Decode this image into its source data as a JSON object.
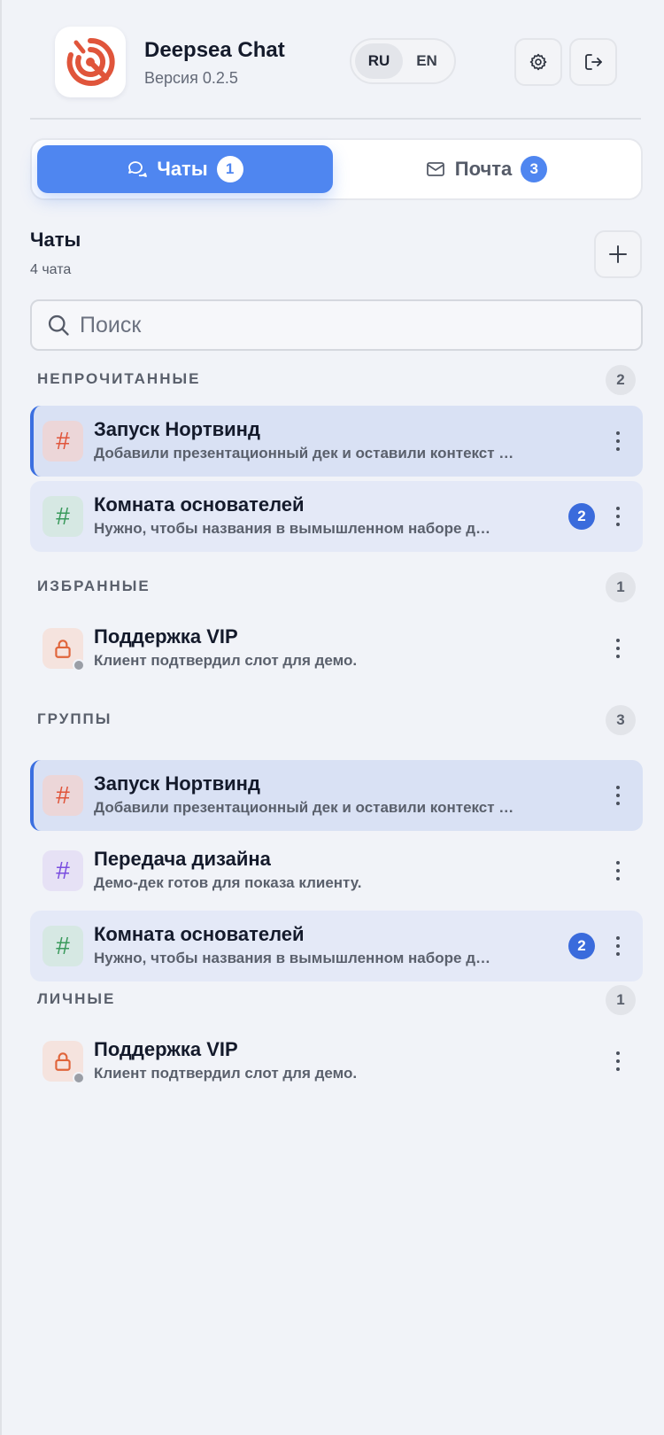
{
  "app": {
    "title": "Deepsea Chat",
    "version": "Версия 0.2.5",
    "brand_color": "#e0553b"
  },
  "languages": [
    {
      "code": "RU",
      "active": true
    },
    {
      "code": "EN",
      "active": false
    }
  ],
  "header_icons": [
    "gear-icon",
    "logout-icon"
  ],
  "tabs": [
    {
      "label": "Чаты",
      "badge": "1",
      "icon": "chat-bubbles-icon",
      "active": true
    },
    {
      "label": "Почта",
      "badge": "3",
      "icon": "envelope-icon",
      "active": false
    }
  ],
  "list": {
    "title": "Чаты",
    "count": "4 чата"
  },
  "search": {
    "placeholder": "Поиск",
    "value": ""
  },
  "groups": [
    {
      "label": "НЕПРОЧИТАННЫЕ",
      "count": "2",
      "items": [
        {
          "name": "Запуск Нортвинд",
          "preview": "Добавили презентационный дек и оставили контекст …",
          "icon": "#",
          "icon_color": "#e0553b",
          "icon_bg": "#ecd6d8",
          "state": "selected",
          "unread": ""
        },
        {
          "name": "Комната основателей",
          "preview": "Нужно, чтобы названия в вымышленном наборе д…",
          "icon": "#",
          "icon_color": "#3a9a5c",
          "icon_bg": "#d6e8e3",
          "state": "tinted",
          "unread": "2"
        }
      ]
    },
    {
      "label": "ИЗБРАННЫЕ",
      "count": "1",
      "items": [
        {
          "name": "Поддержка VIP",
          "preview": "Клиент подтвердил слот для демо.",
          "icon": "lock",
          "icon_color": "#e0653b",
          "icon_bg": "#f5e3de",
          "state": "plain",
          "unread": "",
          "status": "offline"
        }
      ]
    },
    {
      "label": "ГРУППЫ",
      "count": "3",
      "items": [
        {
          "name": "Запуск Нортвинд",
          "preview": "Добавили презентационный дек и оставили контекст …",
          "icon": "#",
          "icon_color": "#e0553b",
          "icon_bg": "#ecd6d8",
          "state": "selected",
          "unread": ""
        },
        {
          "name": "Передача дизайна",
          "preview": "Демо-дек готов для показа клиенту.",
          "icon": "#",
          "icon_color": "#7a4ee0",
          "icon_bg": "#e6e1f5",
          "state": "plain",
          "unread": ""
        },
        {
          "name": "Комната основателей",
          "preview": "Нужно, чтобы названия в вымышленном наборе д…",
          "icon": "#",
          "icon_color": "#3a9a5c",
          "icon_bg": "#d6e8e3",
          "state": "tinted",
          "unread": "2"
        }
      ]
    },
    {
      "label": "ЛИЧНЫЕ",
      "count": "1",
      "items": [
        {
          "name": "Поддержка VIP",
          "preview": "Клиент подтвердил слот для демо.",
          "icon": "lock",
          "icon_color": "#e0653b",
          "icon_bg": "#f5e3de",
          "state": "plain",
          "unread": "",
          "status": "offline"
        }
      ]
    }
  ]
}
